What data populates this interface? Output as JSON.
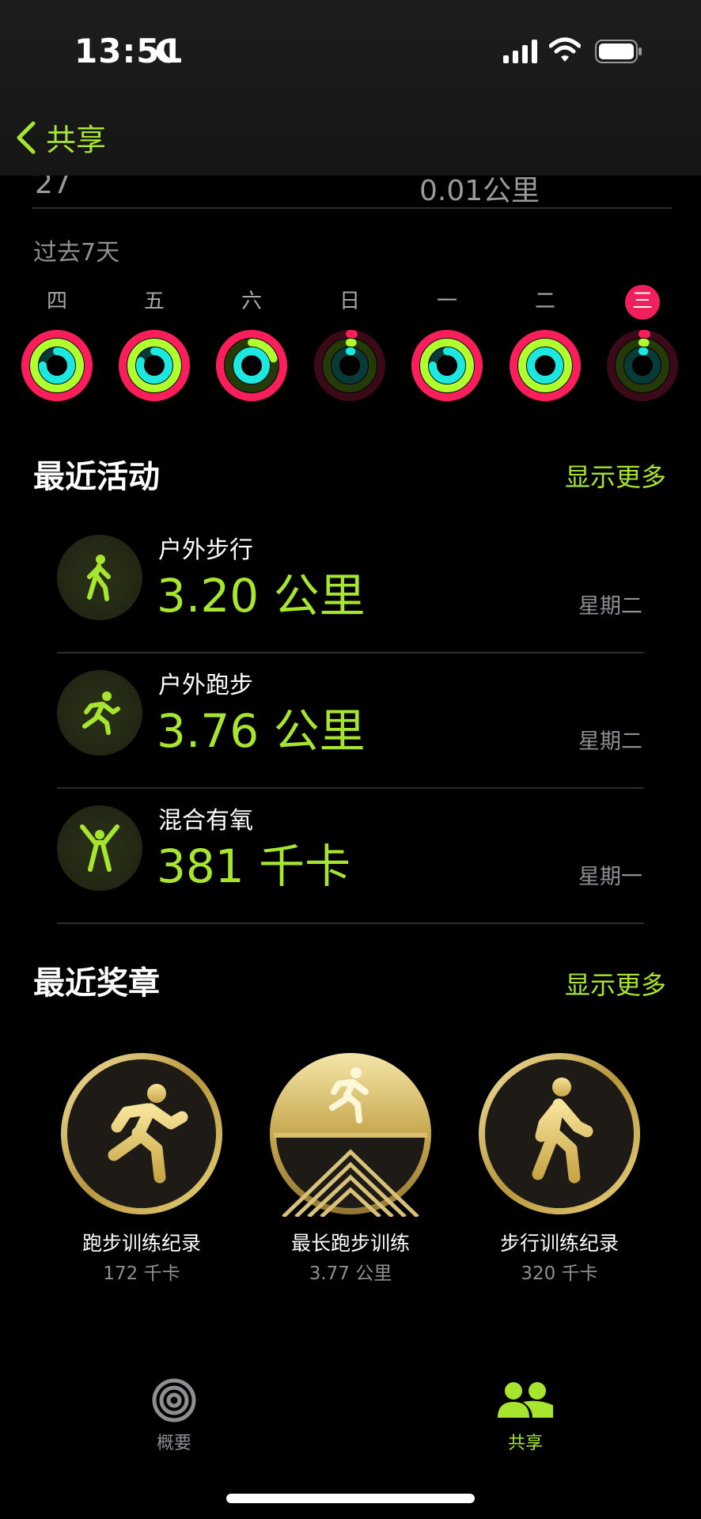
{
  "status": {
    "time": "13:51"
  },
  "nav": {
    "back_label": "共享"
  },
  "partial_row": {
    "left": "27",
    "right": "0.01公里"
  },
  "past_label": "过去7天",
  "week": [
    {
      "label": "四",
      "today": false
    },
    {
      "label": "五",
      "today": false
    },
    {
      "label": "六",
      "today": false
    },
    {
      "label": "日",
      "today": false
    },
    {
      "label": "一",
      "today": false
    },
    {
      "label": "二",
      "today": false
    },
    {
      "label": "三",
      "today": true
    }
  ],
  "rings": [
    {
      "move": 1.0,
      "exercise": 1.0,
      "stand": 0.75
    },
    {
      "move": 1.0,
      "exercise": 1.0,
      "stand": 0.8
    },
    {
      "move": 1.0,
      "exercise": 0.2,
      "stand": 1.0
    },
    {
      "move": 0.02,
      "exercise": 0.02,
      "stand": 0.02
    },
    {
      "move": 1.0,
      "exercise": 1.0,
      "stand": 0.75
    },
    {
      "move": 1.0,
      "exercise": 1.0,
      "stand": 1.0
    },
    {
      "move": 0.02,
      "exercise": 0.02,
      "stand": 0.02
    }
  ],
  "colors": {
    "accent": "#a8e52f",
    "move": "#fa1f5a",
    "exercise": "#b0ff2e",
    "stand": "#1ce8e0",
    "today": "#f0205c"
  },
  "recent_activity": {
    "title": "最近活动",
    "more": "显示更多",
    "items": [
      {
        "name": "户外步行",
        "value": "3.20 公里",
        "day": "星期二",
        "icon": "walking-icon"
      },
      {
        "name": "户外跑步",
        "value": "3.76 公里",
        "day": "星期二",
        "icon": "running-icon"
      },
      {
        "name": "混合有氧",
        "value": "381 千卡",
        "day": "星期一",
        "icon": "aerobic-icon"
      }
    ]
  },
  "recent_awards": {
    "title": "最近奖章",
    "more": "显示更多",
    "items": [
      {
        "name": "跑步训练纪录",
        "sub": "172 千卡",
        "icon": "running-medal-icon"
      },
      {
        "name": "最长跑步训练",
        "sub": "3.77 公里",
        "icon": "longest-run-medal-icon"
      },
      {
        "name": "步行训练纪录",
        "sub": "320 千卡",
        "icon": "walking-medal-icon"
      }
    ]
  },
  "tabbar": {
    "summary": "概要",
    "sharing": "共享"
  }
}
